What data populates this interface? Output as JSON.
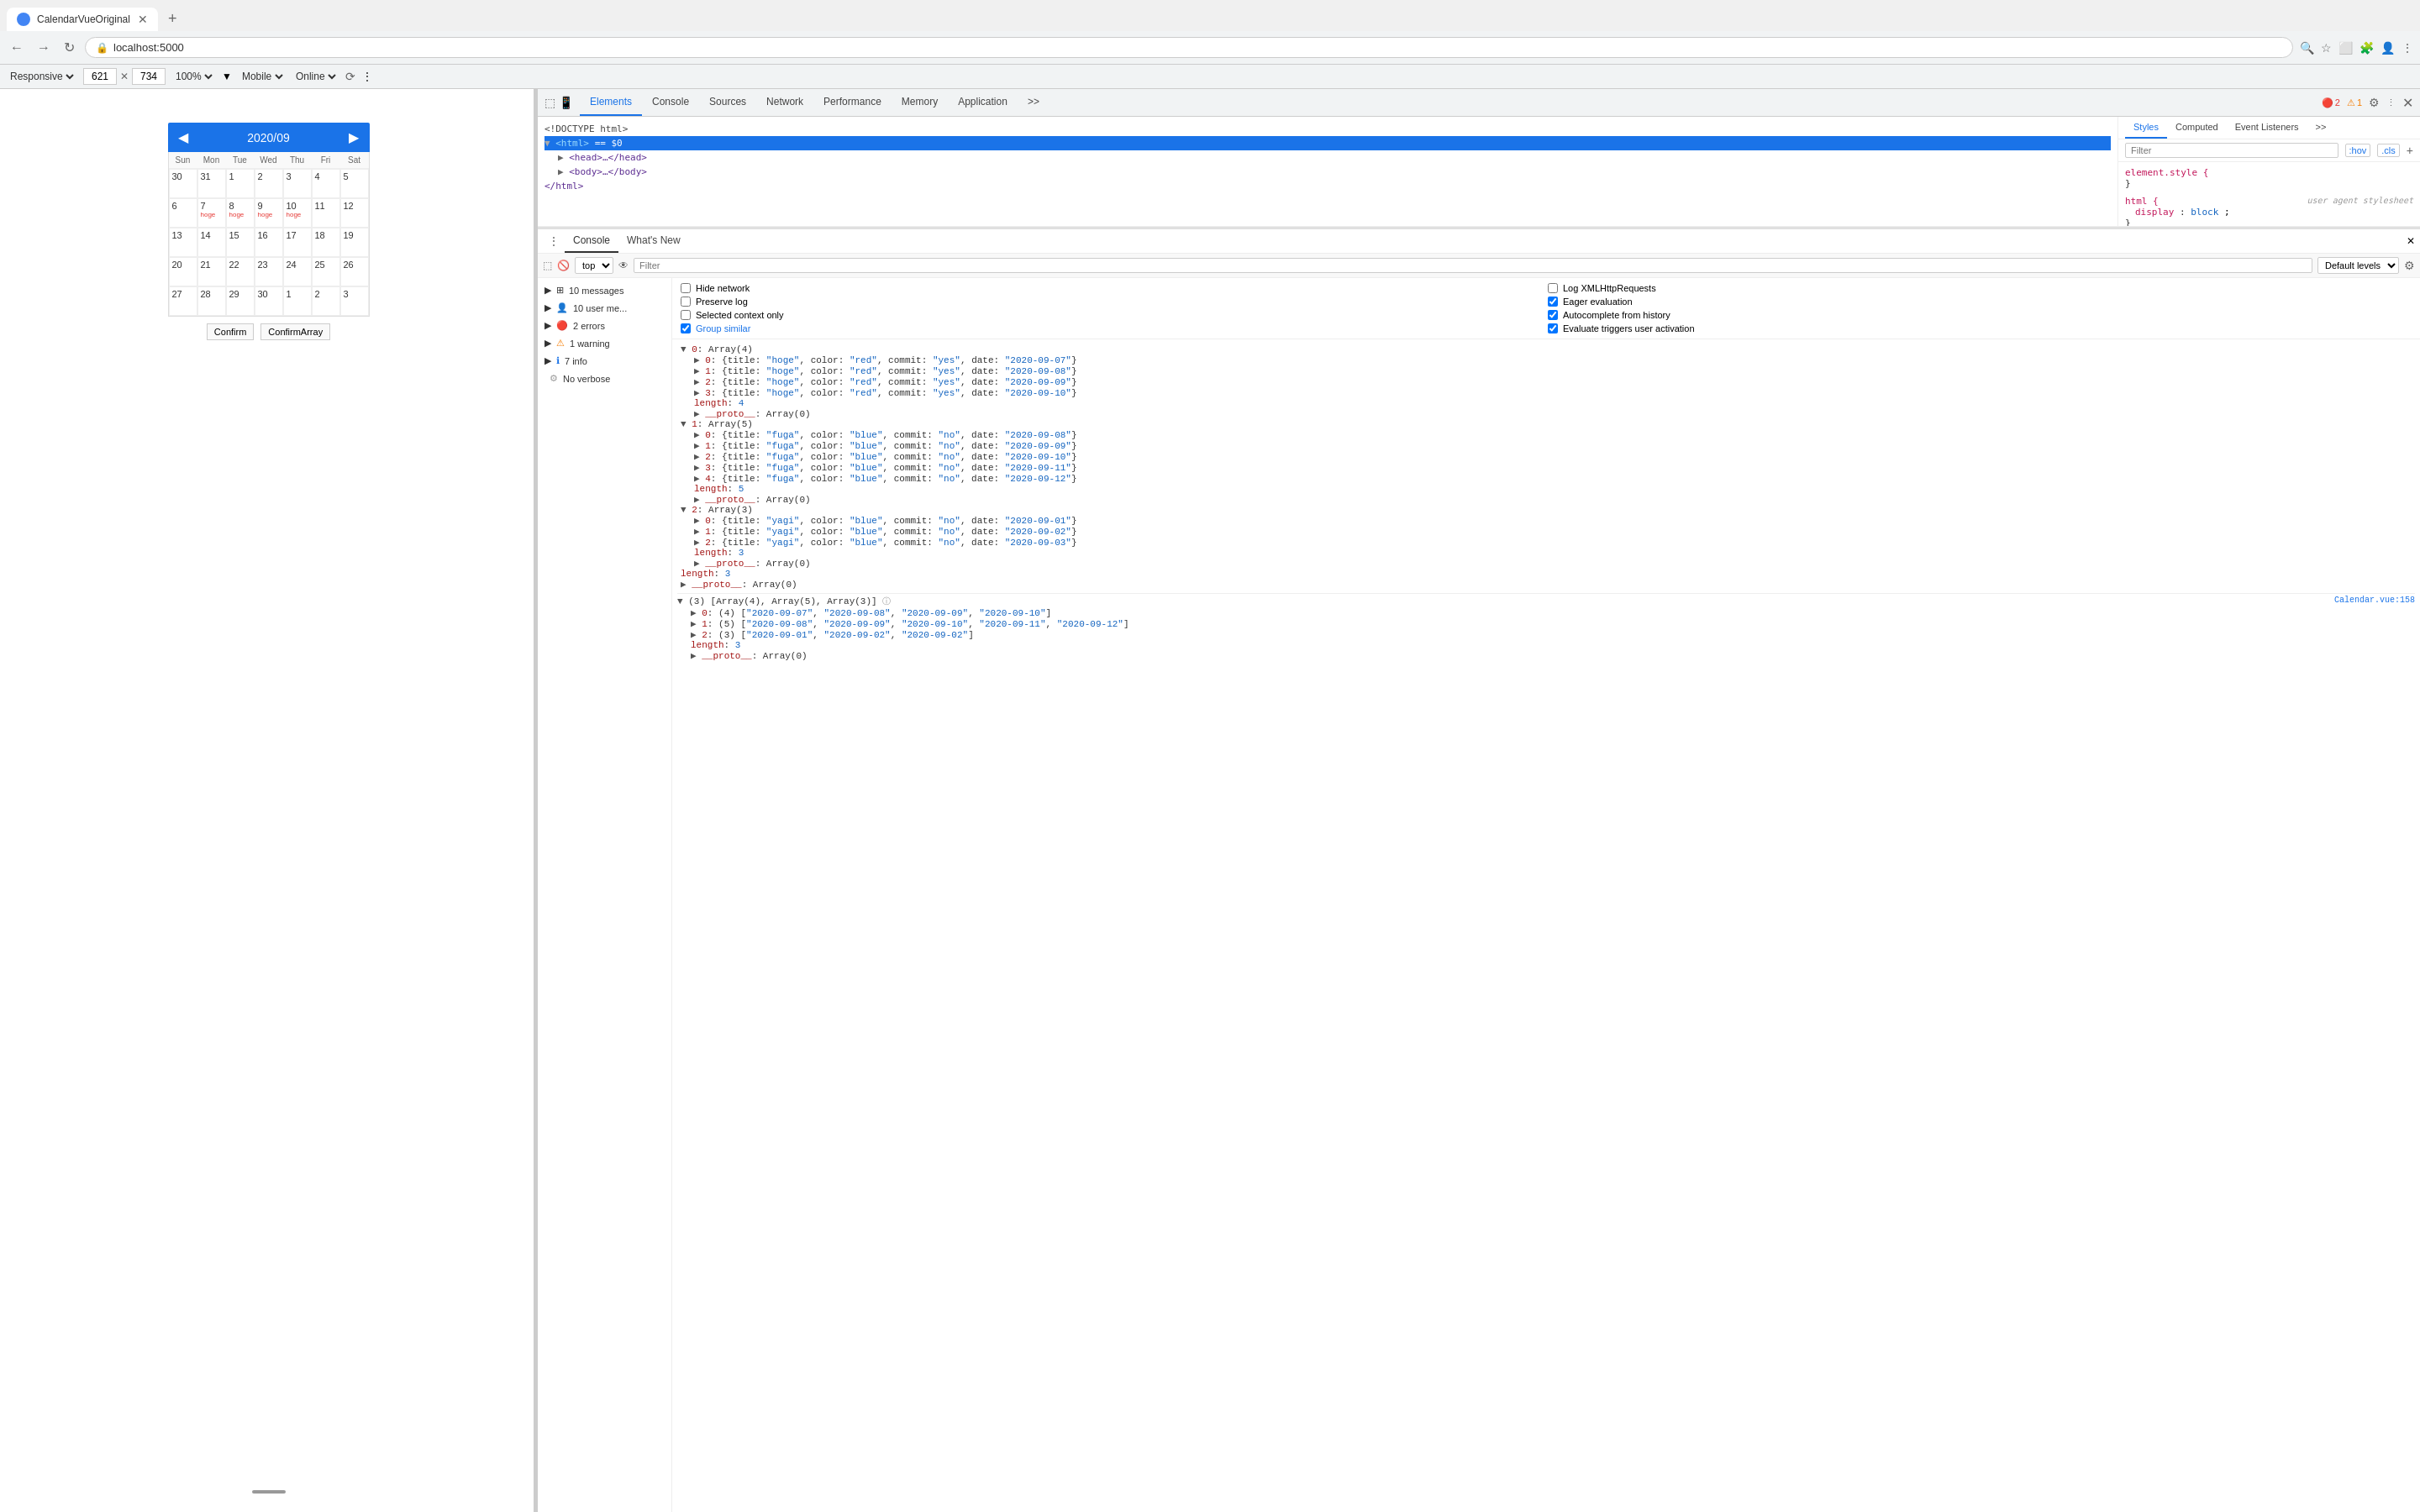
{
  "browser": {
    "tab_title": "CalendarVueOriginal",
    "url": "localhost:5000",
    "new_tab_label": "+",
    "back_tooltip": "Back",
    "forward_tooltip": "Forward",
    "reload_tooltip": "Reload"
  },
  "responsive_bar": {
    "responsive_label": "Responsive",
    "width": "621",
    "height": "734",
    "zoom": "100%",
    "mobile_label": "Mobile",
    "online_label": "Online"
  },
  "calendar": {
    "month": "2020/09",
    "days_of_week": [
      "Sun",
      "Mon",
      "Tue",
      "Wed",
      "Thu",
      "Fri",
      "Sat"
    ],
    "prev_label": "◀",
    "next_label": "▶",
    "weeks": [
      [
        {
          "date": "30",
          "other": true,
          "events": []
        },
        {
          "date": "31",
          "other": true,
          "events": []
        },
        {
          "date": "1",
          "other": false,
          "events": []
        },
        {
          "date": "2",
          "other": false,
          "events": []
        },
        {
          "date": "3",
          "other": false,
          "events": []
        },
        {
          "date": "4",
          "other": false,
          "events": []
        },
        {
          "date": "5",
          "other": false,
          "events": []
        }
      ],
      [
        {
          "date": "6",
          "other": false,
          "events": []
        },
        {
          "date": "7",
          "other": false,
          "events": [
            "hoge"
          ]
        },
        {
          "date": "8",
          "other": false,
          "events": [
            "hoge"
          ]
        },
        {
          "date": "9",
          "other": false,
          "events": [
            "hoge"
          ]
        },
        {
          "date": "10",
          "other": false,
          "events": [
            "hoge"
          ]
        },
        {
          "date": "11",
          "other": false,
          "events": []
        },
        {
          "date": "12",
          "other": false,
          "events": []
        }
      ],
      [
        {
          "date": "13",
          "other": false,
          "events": []
        },
        {
          "date": "14",
          "other": false,
          "events": []
        },
        {
          "date": "15",
          "other": false,
          "events": []
        },
        {
          "date": "16",
          "other": false,
          "events": []
        },
        {
          "date": "17",
          "other": false,
          "events": []
        },
        {
          "date": "18",
          "other": false,
          "events": []
        },
        {
          "date": "19",
          "other": false,
          "events": []
        }
      ],
      [
        {
          "date": "20",
          "other": false,
          "events": []
        },
        {
          "date": "21",
          "other": false,
          "events": []
        },
        {
          "date": "22",
          "other": false,
          "events": []
        },
        {
          "date": "23",
          "other": false,
          "events": []
        },
        {
          "date": "24",
          "other": false,
          "events": []
        },
        {
          "date": "25",
          "other": false,
          "events": []
        },
        {
          "date": "26",
          "other": false,
          "events": []
        }
      ],
      [
        {
          "date": "27",
          "other": false,
          "events": []
        },
        {
          "date": "28",
          "other": false,
          "events": []
        },
        {
          "date": "29",
          "other": false,
          "events": []
        },
        {
          "date": "30",
          "other": false,
          "events": []
        },
        {
          "date": "1",
          "other": true,
          "events": []
        },
        {
          "date": "2",
          "other": true,
          "events": []
        },
        {
          "date": "3",
          "other": true,
          "events": []
        }
      ]
    ],
    "confirm_btn": "Confirm",
    "confirm_array_btn": "ConfirmArray"
  },
  "devtools": {
    "tabs": [
      "Elements",
      "Console",
      "Sources",
      "Network",
      "Performance",
      "Memory",
      "Application",
      ">>"
    ],
    "active_tab": "Console",
    "settings_icon": "⚙",
    "close_icon": "✕",
    "error_count": "2",
    "warn_count": "1",
    "dom_lines": [
      {
        "indent": 0,
        "text": "<!DOCTYPE html>"
      },
      {
        "indent": 0,
        "text": "▼ <html> == $0",
        "selected": true
      },
      {
        "indent": 1,
        "text": "▶ <head>…</head>"
      },
      {
        "indent": 1,
        "text": "▶ <body>…</body>"
      },
      {
        "indent": 0,
        "text": "</html>"
      }
    ]
  },
  "styles": {
    "tabs": [
      "Styles",
      "Computed",
      "Event Listeners",
      ">>"
    ],
    "active_tab": "Styles",
    "filter_placeholder": "Filter",
    "hov_label": ":hov",
    "cls_label": ".cls",
    "add_style_label": "+",
    "rule1": {
      "selector": "element.style {",
      "close": "}",
      "properties": []
    },
    "rule2": {
      "selector": "html {",
      "source": "user agent stylesheet",
      "properties": [
        "display: block;"
      ],
      "close": "}"
    }
  },
  "console": {
    "tabs": [
      "Console",
      "What's New"
    ],
    "active_tab": "Console",
    "top_label": "top",
    "filter_placeholder": "Filter",
    "default_levels": "Default levels",
    "messages_count": "10 messages",
    "sidebar_items": [
      {
        "icon": "user",
        "label": "10 user me..."
      },
      {
        "icon": "error",
        "label": "2 errors"
      },
      {
        "icon": "warn",
        "label": "1 warning"
      },
      {
        "icon": "info",
        "label": "7 info"
      },
      {
        "icon": "verbose",
        "label": "No verbose"
      }
    ],
    "checkboxes": [
      {
        "label": "Hide network",
        "checked": false
      },
      {
        "label": "Log XMLHttpRequests",
        "checked": false
      },
      {
        "label": "Preserve log",
        "checked": false
      },
      {
        "label": "Eager evaluation",
        "checked": true
      },
      {
        "label": "Selected context only",
        "checked": false
      },
      {
        "label": "Autocomplete from history",
        "checked": true
      },
      {
        "label": "Group similar",
        "checked": true
      },
      {
        "label": "Evaluate triggers user activation",
        "checked": true
      }
    ],
    "output_lines": [
      {
        "indent": 1,
        "expand": "▼",
        "text": "0: Array(4)"
      },
      {
        "indent": 2,
        "expand": "▶",
        "text": "0: {title: \"hoge\", color: \"red\", commit: \"yes\", date: \"2020-09-07\"}"
      },
      {
        "indent": 2,
        "expand": "▶",
        "text": "1: {title: \"hoge\", color: \"red\", commit: \"yes\", date: \"2020-09-08\"}"
      },
      {
        "indent": 2,
        "expand": "▶",
        "text": "2: {title: \"hoge\", color: \"red\", commit: \"yes\", date: \"2020-09-09\"}"
      },
      {
        "indent": 2,
        "expand": "▶",
        "text": "3: {title: \"hoge\", color: \"red\", commit: \"yes\", date: \"2020-09-10\"}"
      },
      {
        "indent": 2,
        "expand": "",
        "text": "length: 4"
      },
      {
        "indent": 2,
        "expand": "▶",
        "text": "__proto__: Array(0)"
      },
      {
        "indent": 1,
        "expand": "▼",
        "text": "1: Array(5)"
      },
      {
        "indent": 2,
        "expand": "▶",
        "text": "0: {title: \"fuga\", color: \"blue\", commit: \"no\", date: \"2020-09-08\"}"
      },
      {
        "indent": 2,
        "expand": "▶",
        "text": "1: {title: \"fuga\", color: \"blue\", commit: \"no\", date: \"2020-09-09\"}"
      },
      {
        "indent": 2,
        "expand": "▶",
        "text": "2: {title: \"fuga\", color: \"blue\", commit: \"no\", date: \"2020-09-10\"}"
      },
      {
        "indent": 2,
        "expand": "▶",
        "text": "3: {title: \"fuga\", color: \"blue\", commit: \"no\", date: \"2020-09-11\"}"
      },
      {
        "indent": 2,
        "expand": "▶",
        "text": "4: {title: \"fuga\", color: \"blue\", commit: \"no\", date: \"2020-09-12\"}"
      },
      {
        "indent": 2,
        "expand": "",
        "text": "length: 5"
      },
      {
        "indent": 2,
        "expand": "▶",
        "text": "__proto__: Array(0)"
      },
      {
        "indent": 1,
        "expand": "▼",
        "text": "2: Array(3)"
      },
      {
        "indent": 2,
        "expand": "▶",
        "text": "0: {title: \"yagi\", color: \"blue\", commit: \"no\", date: \"2020-09-01\"}"
      },
      {
        "indent": 2,
        "expand": "▶",
        "text": "1: {title: \"yagi\", color: \"blue\", commit: \"no\", date: \"2020-09-02\"}"
      },
      {
        "indent": 2,
        "expand": "▶",
        "text": "2: {title: \"yagi\", color: \"blue\", commit: \"no\", date: \"2020-09-03\"}"
      },
      {
        "indent": 2,
        "expand": "",
        "text": "length: 3"
      },
      {
        "indent": 2,
        "expand": "▶",
        "text": "__proto__: Array(0)"
      },
      {
        "indent": 1,
        "expand": "",
        "text": "length: 3"
      },
      {
        "indent": 1,
        "expand": "▶",
        "text": "__proto__: Array(0)"
      },
      {
        "indent": 0,
        "expand": "",
        "text": ""
      },
      {
        "indent": 0,
        "expand": "▼",
        "text": "(3) [Array(4), Array(5), Array(3)]",
        "source": "Calendar.vue:158"
      },
      {
        "indent": 1,
        "expand": "▶",
        "text": "0: (4) [\"2020-09-07\", \"2020-09-08\", \"2020-09-09\", \"2020-09-10\"]"
      },
      {
        "indent": 1,
        "expand": "▶",
        "text": "1: (5) [\"2020-09-08\", \"2020-09-09\", \"2020-09-10\", \"2020-09-11\", \"2020-09-12\"]"
      },
      {
        "indent": 1,
        "expand": "▶",
        "text": "2: (3) [\"2020-09-01\", \"2020-09-02\", \"2020-09-02\"]"
      },
      {
        "indent": 1,
        "expand": "",
        "text": "length: 3"
      },
      {
        "indent": 1,
        "expand": "▶",
        "text": "__proto__: Array(0)"
      }
    ]
  }
}
